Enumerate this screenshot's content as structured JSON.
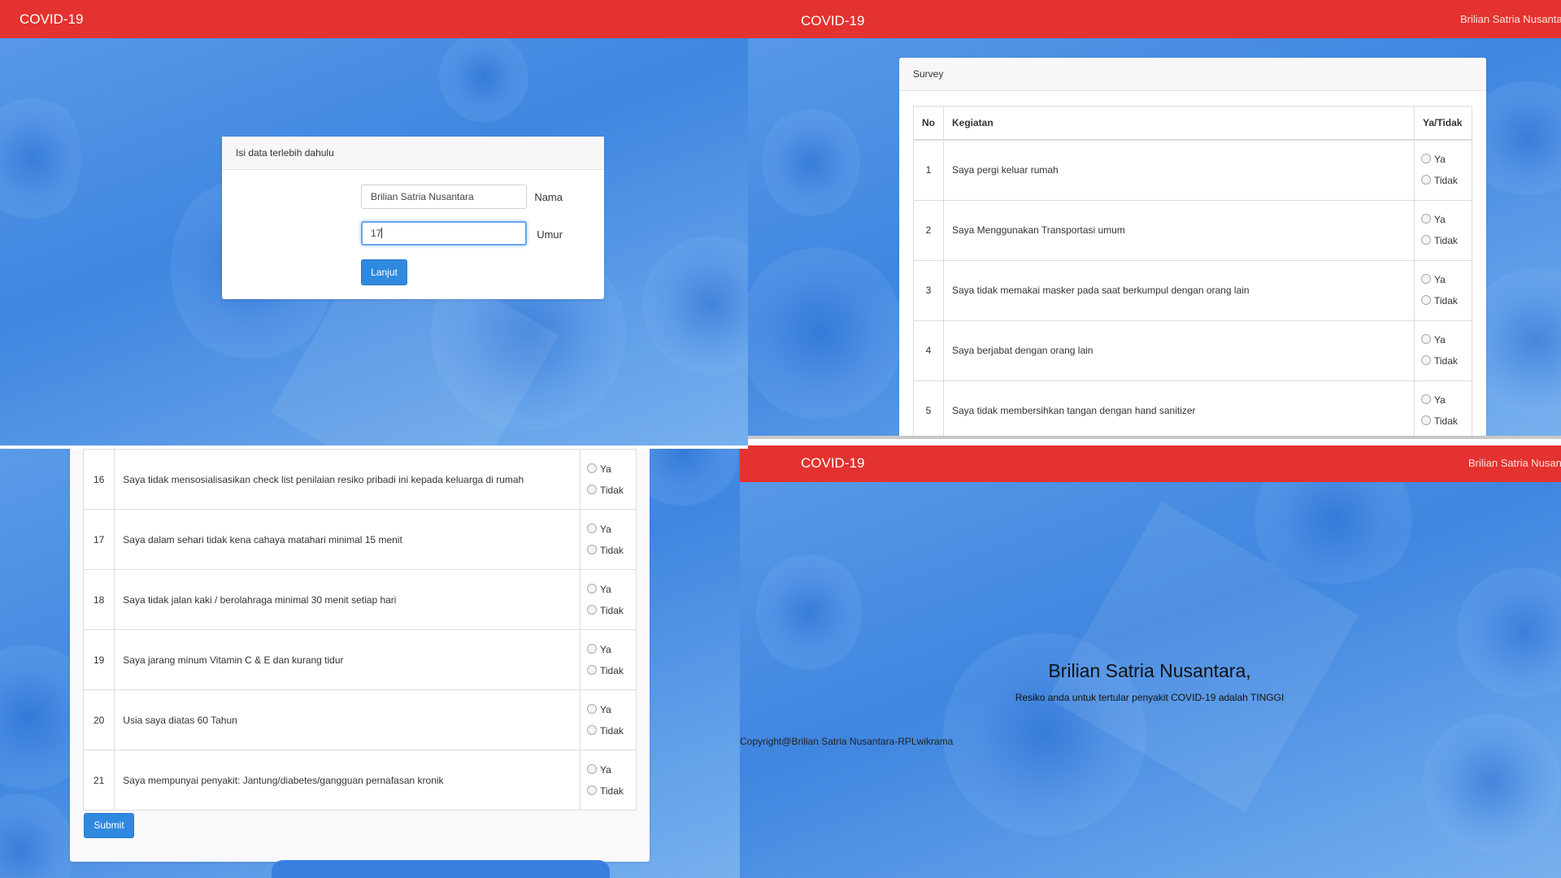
{
  "app_brand": "COVID-19",
  "user_name": "Brilian Satria Nusantara",
  "form": {
    "card_title": "Isi data terlebih dahulu",
    "nama_label": "Nama",
    "nama_value": "Brilian Satria Nusantara",
    "umur_label": "Umur",
    "umur_value": "17",
    "submit_label": "Lanjut"
  },
  "survey": {
    "card_title": "Survey",
    "headers": [
      "No",
      "Kegiatan",
      "Ya/Tidak"
    ],
    "option_yes": "Ya",
    "option_no": "Tidak",
    "rows_top": [
      {
        "no": "1",
        "text": "Saya pergi keluar rumah"
      },
      {
        "no": "2",
        "text": "Saya Menggunakan Transportasi umum"
      },
      {
        "no": "3",
        "text": "Saya tidak memakai masker pada saat berkumpul dengan orang lain"
      },
      {
        "no": "4",
        "text": "Saya berjabat dengan orang lain"
      },
      {
        "no": "5",
        "text": "Saya tidak membersihkan tangan dengan hand sanitizer"
      }
    ],
    "rows_bottom": [
      {
        "no": "16",
        "text": "Saya tidak mensosialisasikan check list penilaian resiko pribadi ini kepada keluarga di rumah"
      },
      {
        "no": "17",
        "text": "Saya dalam sehari tidak kena cahaya matahari minimal 15 menit"
      },
      {
        "no": "18",
        "text": "Saya tidak jalan kaki / berolahraga minimal 30 menit setiap hari"
      },
      {
        "no": "19",
        "text": "Saya jarang minum Vitamin C & E dan kurang tidur"
      },
      {
        "no": "20",
        "text": "Usia saya diatas 60 Tahun"
      },
      {
        "no": "21",
        "text": "Saya mempunyai penyakit: Jantung/diabetes/gangguan pernafasan kronik"
      }
    ],
    "submit_label": "Submit"
  },
  "result": {
    "name_line": "Brilian Satria Nusantara,",
    "message": "Resiko anda untuk tertular penyakit COVID-19 adalah TINGGI",
    "footer": "Copyright@Brilian Satria Nusantara-RPLwikrama"
  }
}
